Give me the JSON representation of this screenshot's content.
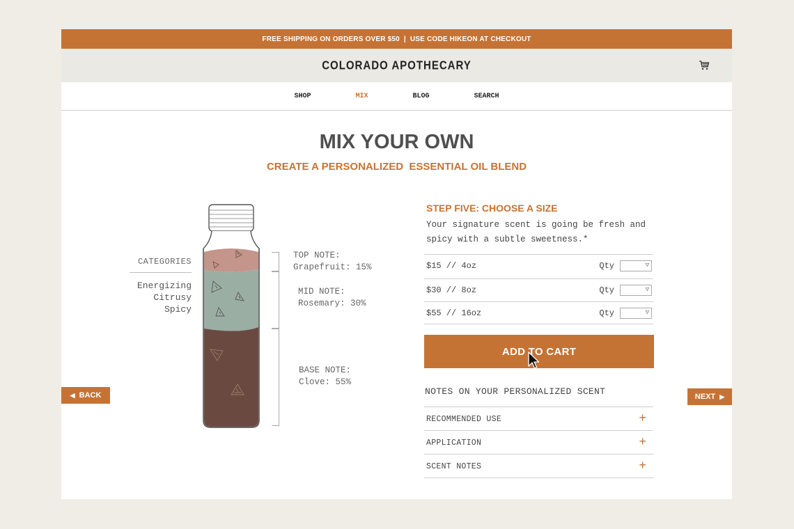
{
  "banner": {
    "text": "FREE SHIPPING ON ORDERS OVER $50  |  USE CODE HIKEON AT CHECKOUT"
  },
  "header": {
    "logo": "COLORADO APOTHECARY",
    "cart_icon": "cart-icon"
  },
  "nav": {
    "items": [
      {
        "label": "SHOP"
      },
      {
        "label": "MIX"
      },
      {
        "label": "BLOG"
      },
      {
        "label": "SEARCH"
      }
    ]
  },
  "page": {
    "title": "MIX YOUR OWN",
    "subtitle": "CREATE A PERSONALIZED  ESSENTIAL OIL BLEND"
  },
  "categories": {
    "heading": "CATEGORIES",
    "items": [
      "Energizing",
      "Citrusy",
      "Spicy"
    ]
  },
  "notes_layers": {
    "top": {
      "label": "TOP NOTE:",
      "value": "Grapefruit: 15%",
      "percent": 15,
      "color": "#c4958a"
    },
    "mid": {
      "label": "MID NOTE:",
      "value": "Rosemary: 30%",
      "percent": 30,
      "color": "#9aaea4"
    },
    "base": {
      "label": "BASE NOTE:",
      "value": "Clove: 55%",
      "percent": 55,
      "color": "#6a4a40"
    }
  },
  "step": {
    "title": "STEP FIVE: CHOOSE A SIZE",
    "description": "Your signature scent is going be fresh and spicy with a subtle sweetness.*",
    "qty_label": "Qty",
    "sizes": [
      {
        "label": "$15 // 4oz"
      },
      {
        "label": "$30 // 8oz"
      },
      {
        "label": "$55 // 16oz"
      }
    ]
  },
  "cart_button": {
    "label": "ADD TO CART"
  },
  "scent_notes": {
    "heading": "NOTES ON YOUR PERSONALIZED SCENT",
    "items": [
      {
        "label": "RECOMMENDED USE"
      },
      {
        "label": "APPLICATION"
      },
      {
        "label": "SCENT NOTES"
      }
    ]
  },
  "pager": {
    "back_label": "BACK",
    "next_label": "NEXT"
  },
  "colors": {
    "accent": "#c57334",
    "header_bg": "#ebe9e4",
    "page_bg": "#f0ede6"
  }
}
